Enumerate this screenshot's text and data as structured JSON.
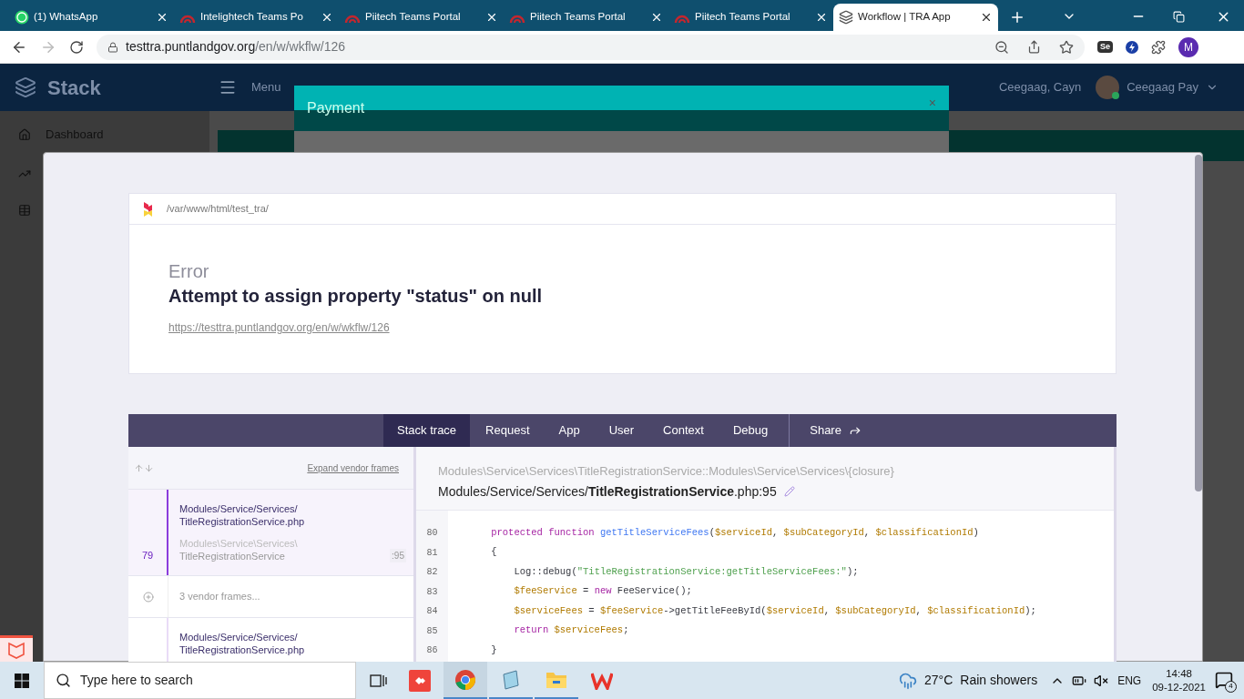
{
  "browser": {
    "tabs": [
      {
        "title": "(1) WhatsApp",
        "kind": "whatsapp",
        "selected": false
      },
      {
        "title": "Intelightech Teams Po",
        "kind": "teams",
        "selected": false
      },
      {
        "title": "Piitech Teams Portal",
        "kind": "teams",
        "selected": false
      },
      {
        "title": "Piitech Teams Portal",
        "kind": "teams",
        "selected": false
      },
      {
        "title": "Piitech Teams Portal",
        "kind": "teams",
        "selected": false
      },
      {
        "title": "Workflow | TRA App",
        "kind": "workflow",
        "selected": true
      }
    ],
    "address": {
      "host": "testtra.puntlandgov.org",
      "path": "/en/w/wkflw/126"
    },
    "extension_label": "Se",
    "profile_initial": "M"
  },
  "app_header": {
    "brand": "Stack",
    "menu": "Menu",
    "user_short": "Ceegaag, Cayn",
    "user_name": "Ceegaag Pay"
  },
  "sidebar": {
    "items": [
      {
        "label": "Dashboard",
        "kind": "home"
      },
      {
        "kind": "chart"
      },
      {
        "kind": "table"
      }
    ]
  },
  "payment_modal": {
    "title": "Payment",
    "close": "×"
  },
  "error_page": {
    "root_path": "/var/www/html/test_tra/",
    "type": "Error",
    "message": "Attempt to assign property \"status\" on null",
    "url": "https://testtra.puntlandgov.org/en/w/wkflw/126",
    "tabs": [
      {
        "label": "Stack trace",
        "selected": true
      },
      {
        "label": "Request",
        "selected": false
      },
      {
        "label": "App",
        "selected": false
      },
      {
        "label": "User",
        "selected": false
      },
      {
        "label": "Context",
        "selected": false
      },
      {
        "label": "Debug",
        "selected": false
      }
    ],
    "share": "Share",
    "expand_vendor": "Expand vendor frames",
    "frames": [
      {
        "kind": "frame",
        "number": "79",
        "path": "Modules/Service/Services/",
        "file": "TitleRegistrationService.php",
        "class_ns": "Modules\\Service\\Services\\",
        "class_name": "TitleRegistrationService",
        "line": ":95",
        "selected": true
      },
      {
        "kind": "vendor",
        "label": "3 vendor frames..."
      },
      {
        "kind": "frame",
        "path": "Modules/Service/Services/",
        "file": "TitleRegistrationService.php",
        "selected": false
      }
    ],
    "code_header": {
      "method": "Modules\\Service\\Services\\TitleRegistrationService::Modules\\Service\\Services\\{closure}",
      "file": "Modules/Service/Services/**TitleRegistrationService**.php:95"
    },
    "code_lines": [
      {
        "number": "80",
        "tokens": [
          {
            "text": "    protected function ",
            "kind": "keyword"
          },
          {
            "text": "getTitleServiceFees",
            "kind": "function"
          },
          {
            "text": "(",
            "kind": "plain"
          },
          {
            "text": "$serviceId",
            "kind": "variable"
          },
          {
            "text": ", ",
            "kind": "plain"
          },
          {
            "text": "$subCategoryId",
            "kind": "variable"
          },
          {
            "text": ", ",
            "kind": "plain"
          },
          {
            "text": "$classificationId",
            "kind": "variable"
          },
          {
            "text": ")",
            "kind": "plain"
          }
        ]
      },
      {
        "number": "81",
        "tokens": [
          {
            "text": "    {",
            "kind": "plain"
          }
        ]
      },
      {
        "number": "82",
        "tokens": [
          {
            "text": "        Log::debug(",
            "kind": "plain"
          },
          {
            "text": "\"TitleRegistrationService:getTitleServiceFees:\"",
            "kind": "string"
          },
          {
            "text": ");",
            "kind": "plain"
          }
        ]
      },
      {
        "number": "83",
        "tokens": [
          {
            "text": "        $feeService",
            "kind": "variable"
          },
          {
            "text": " = ",
            "kind": "plain"
          },
          {
            "text": "new",
            "kind": "keyword"
          },
          {
            "text": " FeeService();",
            "kind": "plain"
          }
        ]
      },
      {
        "number": "84",
        "tokens": [
          {
            "text": "        $serviceFees",
            "kind": "variable"
          },
          {
            "text": " = ",
            "kind": "plain"
          },
          {
            "text": "$feeService",
            "kind": "variable"
          },
          {
            "text": "->getTitleFeeById(",
            "kind": "plain"
          },
          {
            "text": "$serviceId",
            "kind": "variable"
          },
          {
            "text": ", ",
            "kind": "plain"
          },
          {
            "text": "$subCategoryId",
            "kind": "variable"
          },
          {
            "text": ", ",
            "kind": "plain"
          },
          {
            "text": "$classificationId",
            "kind": "variable"
          },
          {
            "text": ");",
            "kind": "plain"
          }
        ]
      },
      {
        "number": "85",
        "tokens": [
          {
            "text": "        return ",
            "kind": "keyword"
          },
          {
            "text": "$serviceFees",
            "kind": "variable"
          },
          {
            "text": ";",
            "kind": "plain"
          }
        ]
      },
      {
        "number": "86",
        "tokens": [
          {
            "text": "    }",
            "kind": "plain"
          }
        ]
      }
    ]
  },
  "taskbar": {
    "search_placeholder": "Type here to search",
    "temperature": "27°C",
    "weather": "Rain showers",
    "language": "ENG",
    "time": "14:48",
    "date": "09-12-2021",
    "notifications": "4"
  }
}
